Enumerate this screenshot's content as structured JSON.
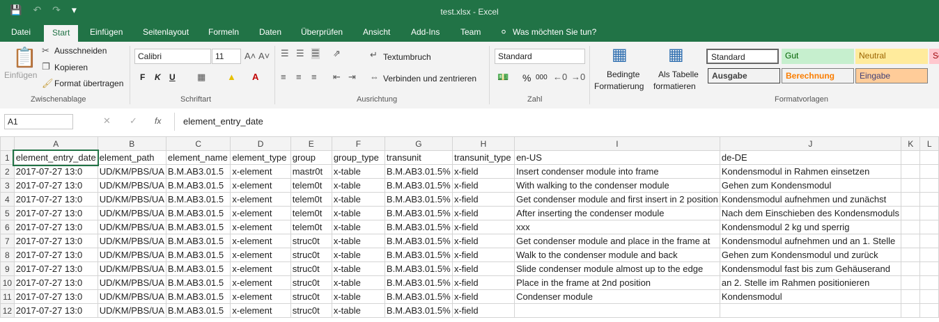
{
  "window": {
    "title": "test.xlsx - Excel"
  },
  "tabs": [
    "Datei",
    "Start",
    "Einfügen",
    "Seitenlayout",
    "Formeln",
    "Daten",
    "Überprüfen",
    "Ansicht",
    "Add-Ins",
    "Team",
    "Was möchten Sie tun?"
  ],
  "ribbon": {
    "clipboard": {
      "paste": "Einfügen",
      "cut": "Ausschneiden",
      "copy": "Kopieren",
      "format_painter": "Format übertragen",
      "label": "Zwischenablage"
    },
    "font": {
      "name": "Calibri",
      "size": "11",
      "bold": "F",
      "italic": "K",
      "underline": "U",
      "label": "Schriftart"
    },
    "alignment": {
      "wrap": "Textumbruch",
      "merge": "Verbinden und zentrieren",
      "label": "Ausrichtung"
    },
    "number": {
      "format": "Standard",
      "percent": "%",
      "thousands": "000",
      "label": "Zahl"
    },
    "conditional": {
      "line1": "Bedingte",
      "line2": "Formatierung"
    },
    "as_table": {
      "line1": "Als Tabelle",
      "line2": "formatieren"
    },
    "styles": {
      "standard": "Standard",
      "gut": "Gut",
      "neutral": "Neutral",
      "schlecht": "Sc",
      "ausgabe": "Ausgabe",
      "berechnung": "Berechnung",
      "eingabe": "Eingabe",
      "label": "Formatvorlagen"
    }
  },
  "formula_bar": {
    "name_box": "A1",
    "fx": "fx",
    "content": "element_entry_date"
  },
  "sheet": {
    "columns": [
      "A",
      "B",
      "C",
      "D",
      "E",
      "F",
      "G",
      "H",
      "I",
      "J",
      "K",
      "L"
    ],
    "rows": [
      [
        "element_entry_date",
        "element_path",
        "element_name",
        "element_type",
        "group",
        "group_type",
        "transunit",
        "transunit_type",
        "en-US",
        "de-DE",
        "",
        ""
      ],
      [
        "2017-07-27 13:0",
        "UD/KM/PBS/UA",
        "B.M.AB3.01.5",
        "x-element",
        "mastr0t",
        "x-table",
        "B.M.AB3.01.5%",
        "x-field",
        "Insert condenser module into frame",
        "Kondensmodul in Rahmen einsetzen",
        "",
        ""
      ],
      [
        "2017-07-27 13:0",
        "UD/KM/PBS/UA",
        "B.M.AB3.01.5",
        "x-element",
        "telem0t",
        "x-table",
        "B.M.AB3.01.5%",
        "x-field",
        "With walking to the condenser module",
        "Gehen zum Kondensmodul",
        "",
        ""
      ],
      [
        "2017-07-27 13:0",
        "UD/KM/PBS/UA",
        "B.M.AB3.01.5",
        "x-element",
        "telem0t",
        "x-table",
        "B.M.AB3.01.5%",
        "x-field",
        "Get condenser module and first insert in 2 position",
        "Kondensmodul aufnehmen und zunächst",
        "",
        ""
      ],
      [
        "2017-07-27 13:0",
        "UD/KM/PBS/UA",
        "B.M.AB3.01.5",
        "x-element",
        "telem0t",
        "x-table",
        "B.M.AB3.01.5%",
        "x-field",
        "After inserting the condenser module",
        "Nach dem Einschieben des Kondensmoduls",
        "",
        ""
      ],
      [
        "2017-07-27 13:0",
        "UD/KM/PBS/UA",
        "B.M.AB3.01.5",
        "x-element",
        "telem0t",
        "x-table",
        "B.M.AB3.01.5%",
        "x-field",
        "xxx",
        "Kondensmodul 2 kg und sperrig",
        "",
        ""
      ],
      [
        "2017-07-27 13:0",
        "UD/KM/PBS/UA",
        "B.M.AB3.01.5",
        "x-element",
        "struc0t",
        "x-table",
        "B.M.AB3.01.5%",
        "x-field",
        "Get condenser module and place in the frame at",
        "Kondensmodul aufnehmen und an 1. Stelle",
        "",
        ""
      ],
      [
        "2017-07-27 13:0",
        "UD/KM/PBS/UA",
        "B.M.AB3.01.5",
        "x-element",
        "struc0t",
        "x-table",
        "B.M.AB3.01.5%",
        "x-field",
        "Walk to the condenser module and back",
        "Gehen zum Kondensmodul und zurück",
        "",
        ""
      ],
      [
        "2017-07-27 13:0",
        "UD/KM/PBS/UA",
        "B.M.AB3.01.5",
        "x-element",
        "struc0t",
        "x-table",
        "B.M.AB3.01.5%",
        "x-field",
        "Slide condenser module almost up to the edge",
        "Kondensmodul fast bis zum Gehäuserand",
        "",
        ""
      ],
      [
        "2017-07-27 13:0",
        "UD/KM/PBS/UA",
        "B.M.AB3.01.5",
        "x-element",
        "struc0t",
        "x-table",
        "B.M.AB3.01.5%",
        "x-field",
        "Place in the frame at 2nd position",
        "an 2. Stelle im Rahmen positionieren",
        "",
        ""
      ],
      [
        "2017-07-27 13:0",
        "UD/KM/PBS/UA",
        "B.M.AB3.01.5",
        "x-element",
        "struc0t",
        "x-table",
        "B.M.AB3.01.5%",
        "x-field",
        "Condenser module",
        "Kondensmodul",
        "",
        ""
      ],
      [
        "2017-07-27 13:0",
        "UD/KM/PBS/UA",
        "B.M.AB3.01.5",
        "x-element",
        "struc0t",
        "x-table",
        "B.M.AB3.01.5%",
        "x-field",
        "",
        "",
        "",
        ""
      ]
    ]
  }
}
